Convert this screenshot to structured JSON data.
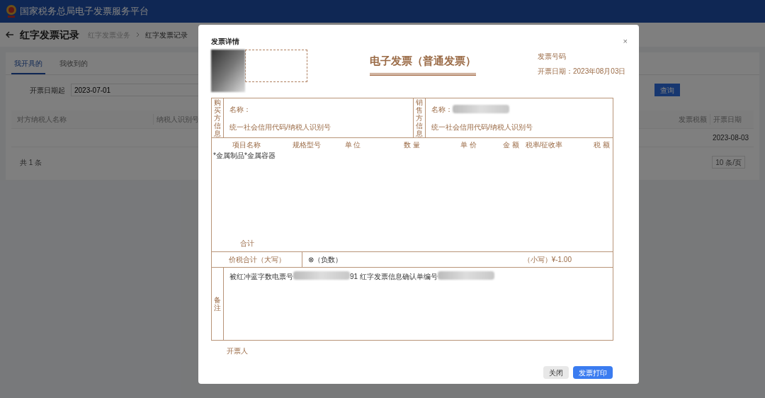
{
  "header": {
    "title": "国家税务总局电子发票服务平台"
  },
  "page": {
    "title": "红字发票记录",
    "breadcrumb": [
      {
        "label": "红字发票业务",
        "current": false
      },
      {
        "label": "红字发票记录",
        "current": true
      }
    ]
  },
  "tabs": [
    {
      "label": "我开具的",
      "selected": true
    },
    {
      "label": "我收到的",
      "selected": false
    }
  ],
  "filter": {
    "label": "开票日期起",
    "value": "2023-07-01",
    "button": "查询"
  },
  "table": {
    "columns": [
      "对方纳税人名称",
      "纳税人识别号",
      "发票税额",
      "开票日期"
    ],
    "rows": [
      {
        "date": "2023-08-03"
      }
    ]
  },
  "pagination": {
    "total": "共 1 条",
    "page_size": "10 条/页"
  },
  "dialog": {
    "title": "发票详情",
    "close": "×",
    "invoice": {
      "title": "电子发票（普通发票）",
      "number_label": "发票号码",
      "date": "开票日期：2023年08月03日",
      "buyer": {
        "side": "购买方信息",
        "name_label": "名称：",
        "id_label": "统一社会信用代码/纳税人识别号"
      },
      "seller": {
        "side": "销售方信息",
        "name_label": "名称：",
        "id_label": "统一社会信用代码/纳税人识别号"
      },
      "item_columns": [
        "项目名称",
        "规格型号",
        "单 位",
        "数 量",
        "单 价",
        "金 额",
        "税率/征收率",
        "税 额"
      ],
      "items": [
        {
          "name": "*金属制品*金属容器"
        }
      ],
      "subtotal_label": "合计",
      "total_label": "价税合计（大写）",
      "total_words": "⊗（负数）",
      "total_small": "（小写）¥-1.00",
      "remarks_label": "备注",
      "remarks_text": "被红冲蓝字数电票号",
      "remarks_text_2": "91 红字发票信息确认单编号",
      "issuer_label": "开票人"
    },
    "buttons": [
      {
        "label": "关闭",
        "kind": "secondary"
      },
      {
        "label": "发票打印",
        "kind": "primary"
      }
    ]
  }
}
